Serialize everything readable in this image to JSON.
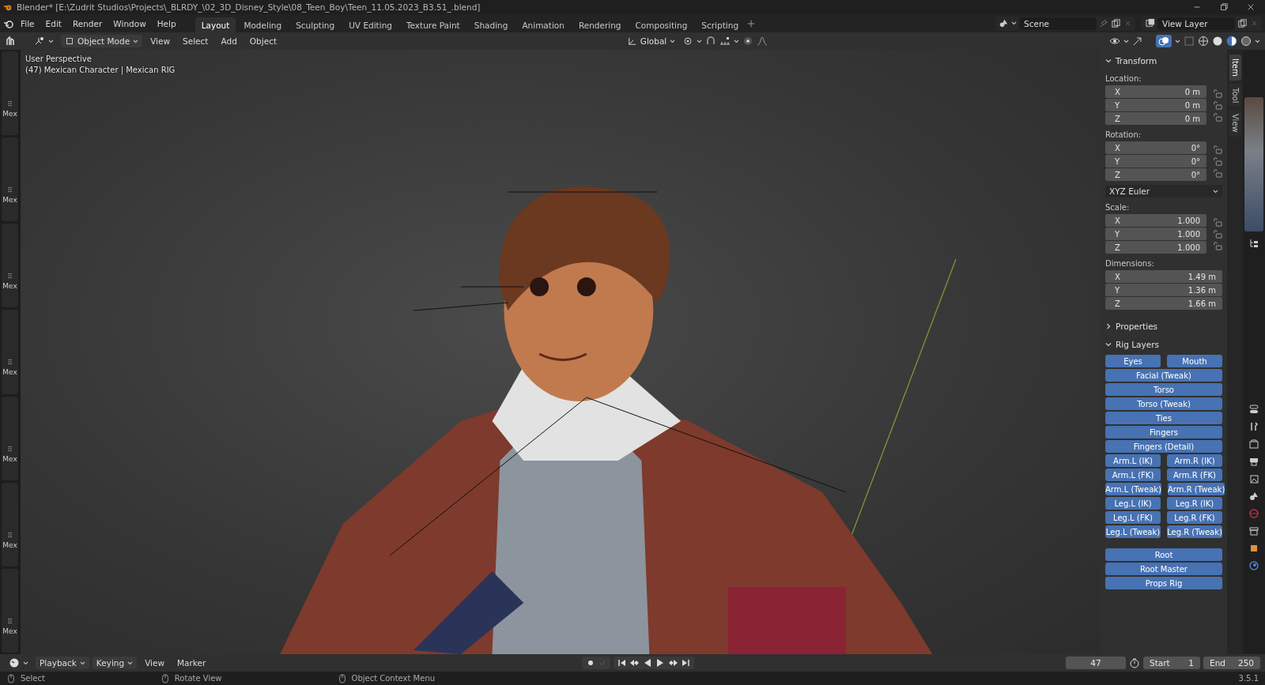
{
  "window": {
    "title": "Blender* [E:\\Zudrit Studios\\Projects\\_BLRDY_\\02_3D_Disney_Style\\08_Teen_Boy\\Teen_11.05.2023_B3.51_.blend]"
  },
  "menu": [
    "File",
    "Edit",
    "Render",
    "Window",
    "Help"
  ],
  "workspaces": [
    {
      "label": "Layout",
      "selected": true
    },
    {
      "label": "Modeling",
      "selected": false
    },
    {
      "label": "Sculpting",
      "selected": false
    },
    {
      "label": "UV Editing",
      "selected": false
    },
    {
      "label": "Texture Paint",
      "selected": false
    },
    {
      "label": "Shading",
      "selected": false
    },
    {
      "label": "Animation",
      "selected": false
    },
    {
      "label": "Rendering",
      "selected": false
    },
    {
      "label": "Compositing",
      "selected": false
    },
    {
      "label": "Scripting",
      "selected": false
    }
  ],
  "scene": "Scene",
  "view_layer": "View Layer",
  "header": {
    "mode": "Object Mode",
    "menus": [
      "View",
      "Select",
      "Add",
      "Object"
    ],
    "orientation": "Global"
  },
  "left_areas": [
    "Mex",
    "Mex",
    "Mex",
    "Mex",
    "Mex",
    "Mex",
    "Mex"
  ],
  "viewport": {
    "view_name": "User Perspective",
    "object_info": "(47) Mexican Character | Mexican RIG"
  },
  "sidebar": {
    "tabs": [
      {
        "label": "Item",
        "selected": true
      },
      {
        "label": "Tool",
        "selected": false
      },
      {
        "label": "View",
        "selected": false
      }
    ],
    "transform": {
      "title": "Transform",
      "expanded": true,
      "groups": [
        {
          "label": "Location:",
          "fields": [
            {
              "axis": "X",
              "value": "0 m",
              "locked": false
            },
            {
              "axis": "Y",
              "value": "0 m",
              "locked": false
            },
            {
              "axis": "Z",
              "value": "0 m",
              "locked": false
            }
          ]
        },
        {
          "label": "Rotation:",
          "fields": [
            {
              "axis": "X",
              "value": "0°",
              "locked": false
            },
            {
              "axis": "Y",
              "value": "0°",
              "locked": false
            },
            {
              "axis": "Z",
              "value": "0°",
              "locked": false
            }
          ],
          "mode": "XYZ Euler"
        },
        {
          "label": "Scale:",
          "fields": [
            {
              "axis": "X",
              "value": "1.000",
              "locked": false
            },
            {
              "axis": "Y",
              "value": "1.000",
              "locked": false
            },
            {
              "axis": "Z",
              "value": "1.000",
              "locked": false
            }
          ]
        },
        {
          "label": "Dimensions:",
          "fields": [
            {
              "axis": "X",
              "value": "1.49 m"
            },
            {
              "axis": "Y",
              "value": "1.36 m"
            },
            {
              "axis": "Z",
              "value": "1.66 m"
            }
          ]
        }
      ]
    },
    "properties": {
      "title": "Properties",
      "expanded": false
    },
    "rig_layers": {
      "title": "Rig Layers",
      "expanded": true,
      "sections": [
        {
          "rows": [
            [
              {
                "label": "Eyes",
                "on": true
              },
              {
                "label": "Mouth",
                "on": true
              }
            ],
            [
              {
                "label": "Facial (Tweak)",
                "on": true
              }
            ],
            [
              {
                "label": "Torso",
                "on": true
              }
            ],
            [
              {
                "label": "Torso (Tweak)",
                "on": true
              }
            ],
            [
              {
                "label": "Ties",
                "on": true
              }
            ],
            [
              {
                "label": "Fingers",
                "on": true
              }
            ],
            [
              {
                "label": "Fingers (Detail)",
                "on": true
              }
            ],
            [
              {
                "label": "Arm.L (IK)",
                "on": true
              },
              {
                "label": "Arm.R (IK)",
                "on": true
              }
            ],
            [
              {
                "label": "Arm.L (FK)",
                "on": true
              },
              {
                "label": "Arm.R (FK)",
                "on": true
              }
            ],
            [
              {
                "label": "Arm.L (Tweak)",
                "on": true
              },
              {
                "label": "Arm.R (Tweak)",
                "on": true
              }
            ],
            [
              {
                "label": "Leg.L (IK)",
                "on": true
              },
              {
                "label": "Leg.R (IK)",
                "on": true
              }
            ],
            [
              {
                "label": "Leg.L (FK)",
                "on": true
              },
              {
                "label": "Leg.R (FK)",
                "on": true
              }
            ],
            [
              {
                "label": "Leg.L (Tweak)",
                "on": true
              },
              {
                "label": "Leg.R (Tweak)",
                "on": true
              }
            ]
          ]
        },
        {
          "rows": [
            [
              {
                "label": "Root",
                "on": true
              }
            ],
            [
              {
                "label": "Root Master",
                "on": true
              }
            ],
            [
              {
                "label": "Props Rig",
                "on": true
              }
            ]
          ]
        }
      ]
    }
  },
  "timeline": {
    "menus": [
      {
        "label": "Playback",
        "dropdown": true
      },
      {
        "label": "Keying",
        "dropdown": true
      },
      {
        "label": "View",
        "dropdown": false
      },
      {
        "label": "Marker",
        "dropdown": false
      }
    ],
    "current_frame": "47",
    "start_label": "Start",
    "start": "1",
    "end_label": "End",
    "end": "250"
  },
  "status_bar": {
    "hints": [
      "Select",
      "Rotate View",
      "Object Context Menu"
    ],
    "version": "3.5.1"
  }
}
